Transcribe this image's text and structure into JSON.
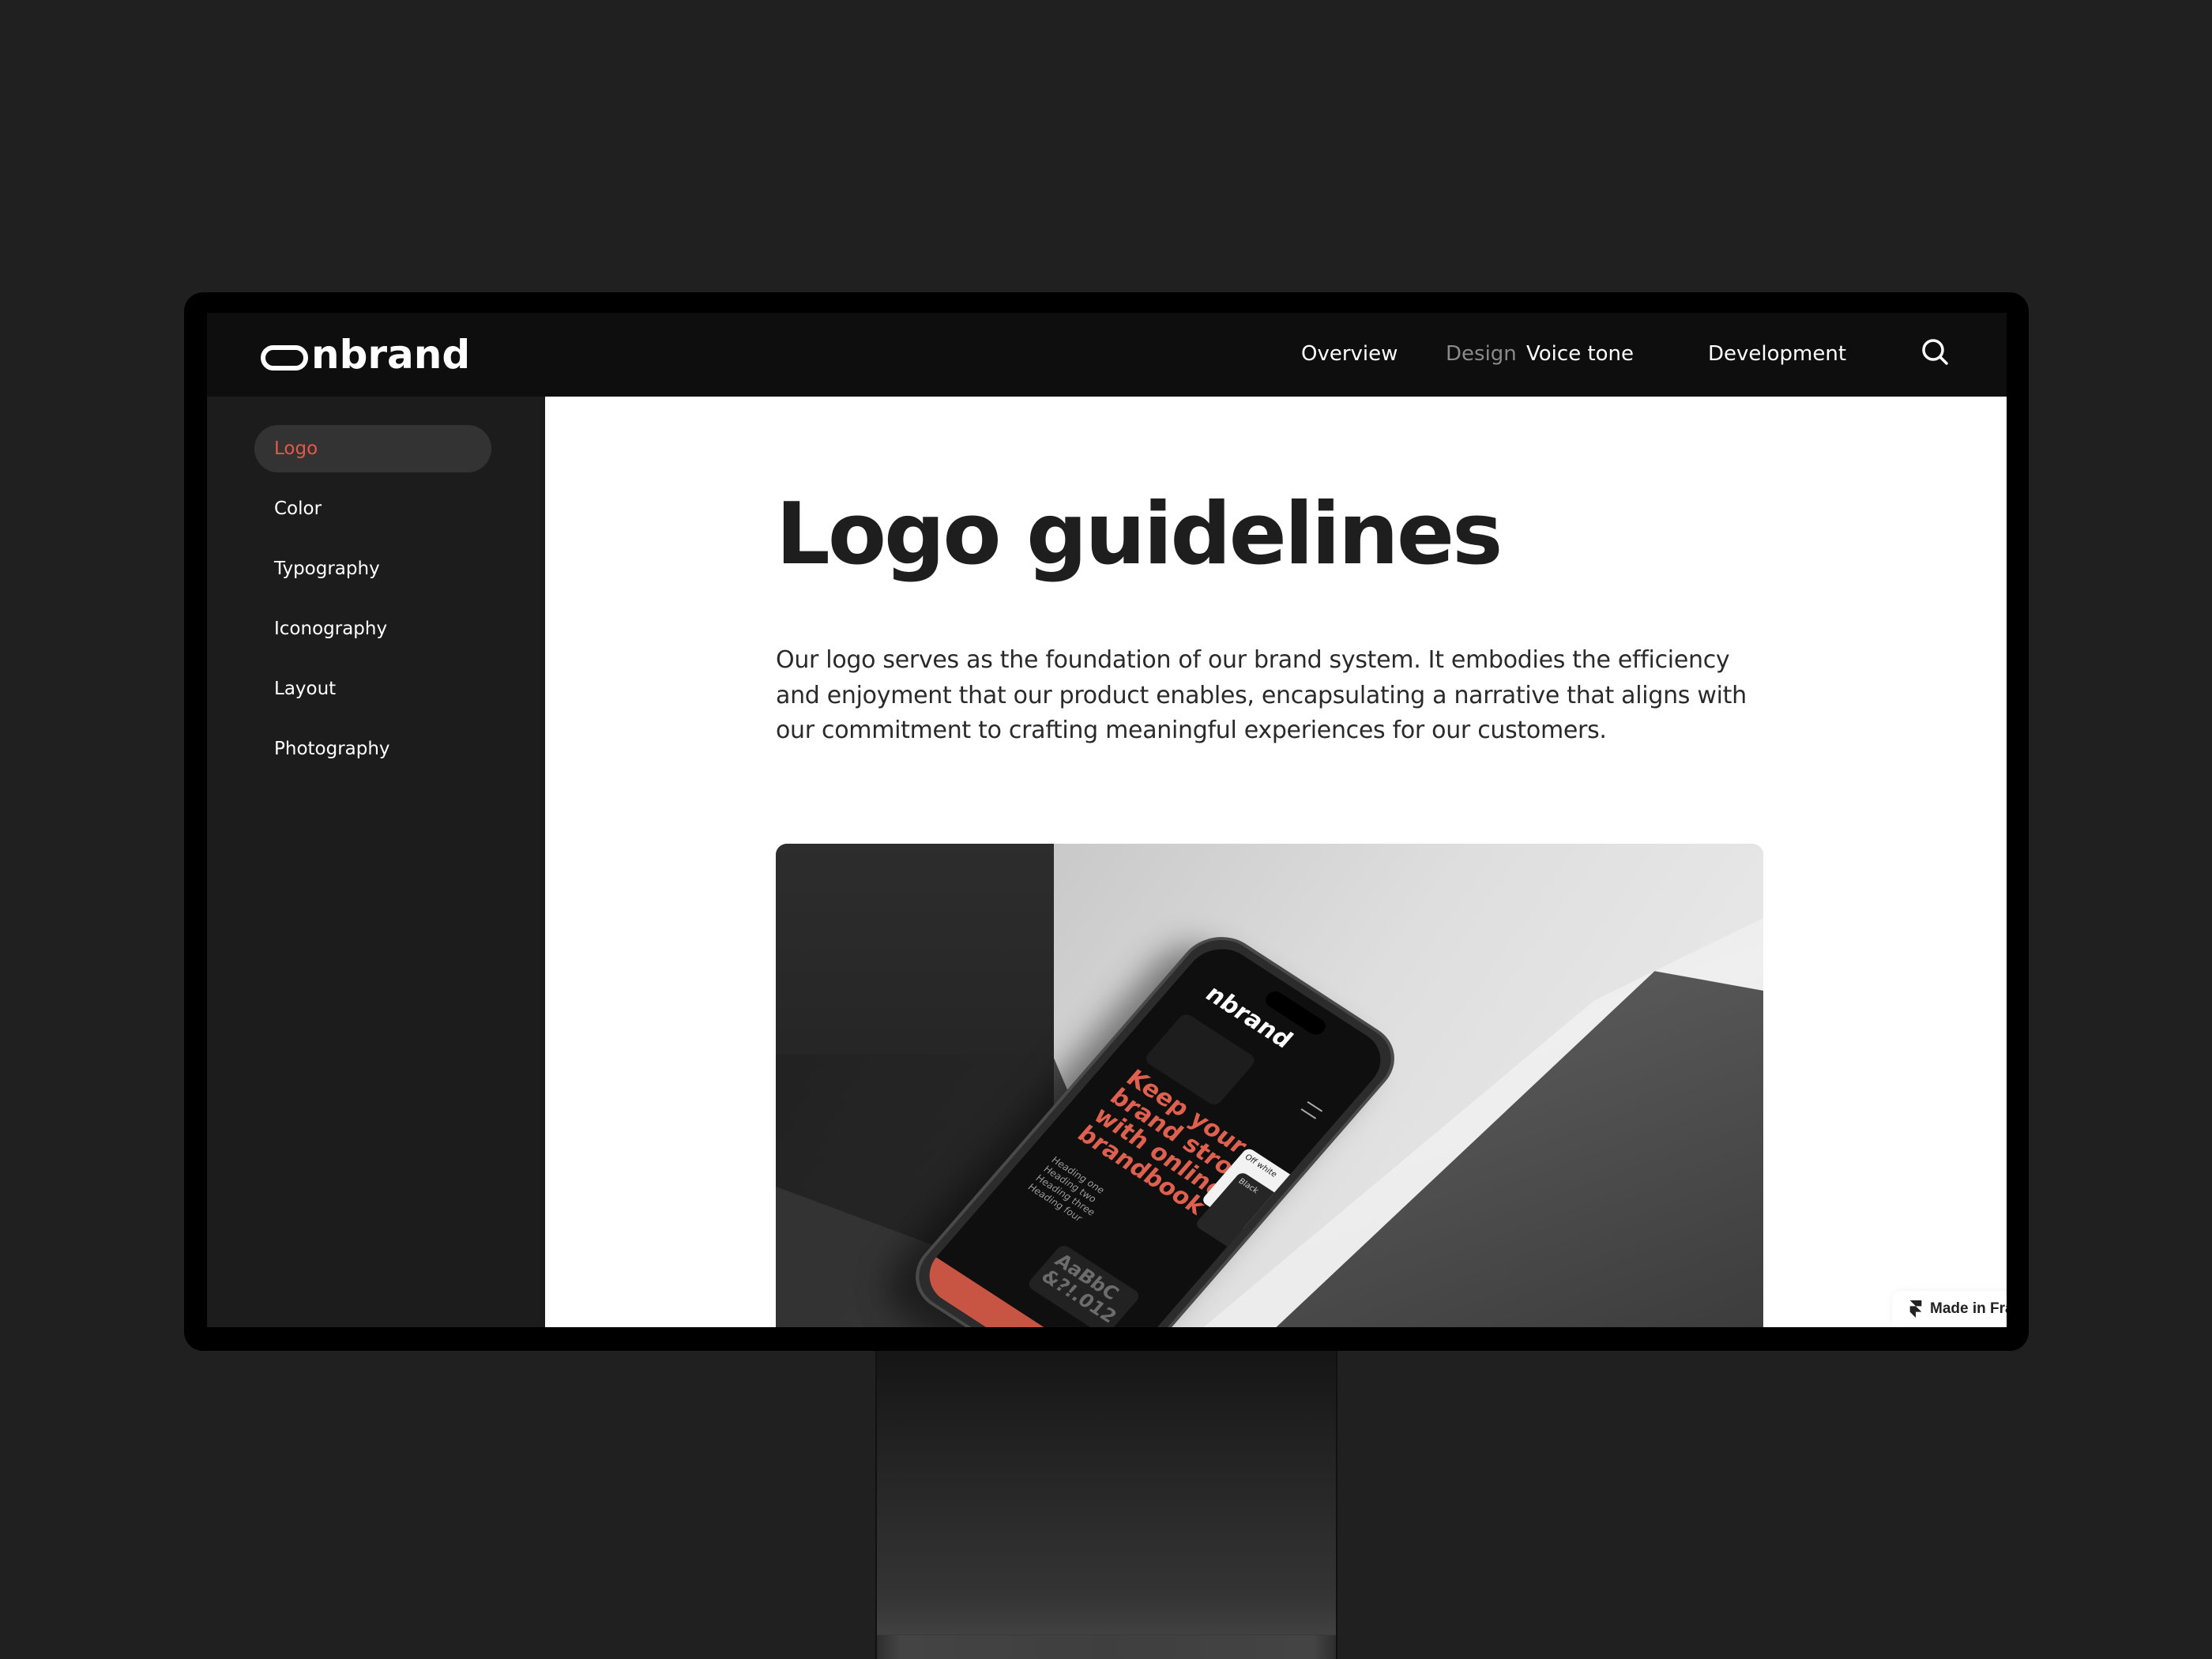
{
  "brand": {
    "name": "nbrand",
    "accent_color": "#e5574a"
  },
  "header": {
    "nav": [
      {
        "label": "Overview",
        "active": false
      },
      {
        "label": "Design",
        "active": true
      },
      {
        "label": "Voice tone",
        "active": false
      },
      {
        "label": "Development",
        "active": false
      }
    ],
    "search_icon": "search-icon"
  },
  "sidebar": {
    "items": [
      {
        "label": "Logo",
        "active": true
      },
      {
        "label": "Color",
        "active": false
      },
      {
        "label": "Typography",
        "active": false
      },
      {
        "label": "Iconography",
        "active": false
      },
      {
        "label": "Layout",
        "active": false
      },
      {
        "label": "Photography",
        "active": false
      }
    ]
  },
  "main": {
    "title": "Logo guidelines",
    "intro": "Our logo serves as the foundation of our brand system. It embodies the efficiency and enjoyment that our product enables, encapsulating a narrative that aligns with our commitment to crafting meaningful experiences for our customers.",
    "image": {
      "phone_logo": "nbrand",
      "phone_headline": "Keep your brand strong with online brandbook",
      "phone_card_light": "Off white",
      "phone_card_dark": "Black",
      "phone_headings": [
        "Heading one",
        "Heading two",
        "Heading three",
        "Heading four"
      ],
      "phone_type_sample": "AaBbC &?!.012"
    }
  },
  "badge": {
    "label": "Made in Framer",
    "icon": "framer-icon"
  }
}
